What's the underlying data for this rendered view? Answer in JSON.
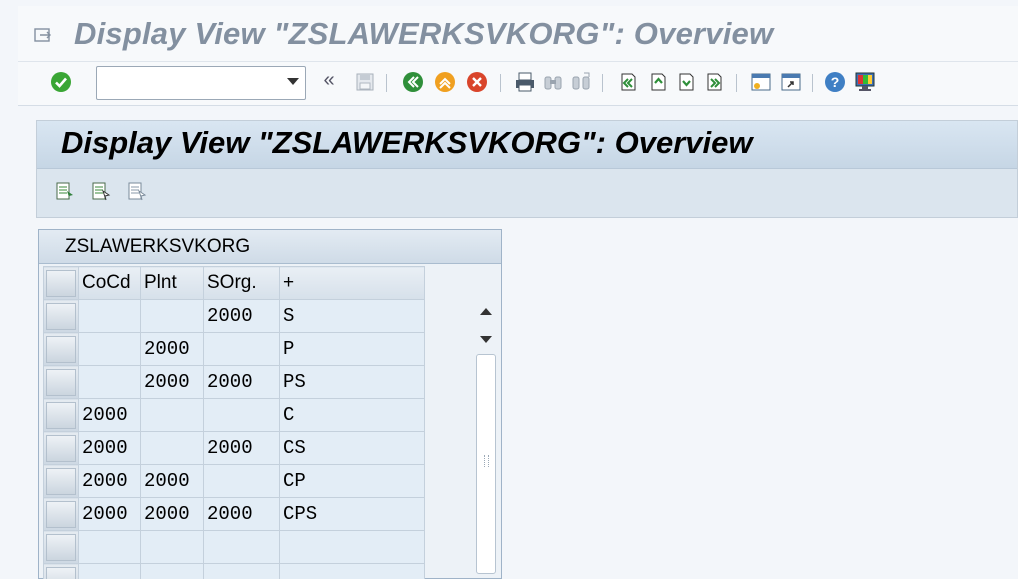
{
  "window": {
    "title": "Display View \"ZSLAWERKSVKORG\": Overview"
  },
  "toolbar": {
    "command_field_value": "",
    "icons": [
      "enter-icon",
      "command-dropdown-icon",
      "collapse-icon",
      "save-icon",
      "back-icon",
      "exit-icon",
      "cancel-icon",
      "print-icon",
      "find-icon",
      "find-next-icon",
      "first-page-icon",
      "previous-page-icon",
      "next-page-icon",
      "last-page-icon",
      "create-session-icon",
      "shortcut-icon",
      "help-icon",
      "customize-layout-icon"
    ],
    "collapse_label": "«"
  },
  "section": {
    "title": "Display View \"ZSLAWERKSVKORG\": Overview",
    "buttons": [
      "details-icon",
      "select-all-icon",
      "deselect-all-icon"
    ]
  },
  "table": {
    "title": "ZSLAWERKSVKORG",
    "columns": [
      "CoCd",
      "Plnt",
      "SOrg.",
      "+"
    ],
    "rows": [
      [
        "",
        "",
        "2000",
        "S"
      ],
      [
        "",
        "2000",
        "",
        "P"
      ],
      [
        "",
        "2000",
        "2000",
        "PS"
      ],
      [
        "2000",
        "",
        "",
        "C"
      ],
      [
        "2000",
        "",
        "2000",
        "CS"
      ],
      [
        "2000",
        "2000",
        "",
        "CP"
      ],
      [
        "2000",
        "2000",
        "2000",
        "CPS"
      ],
      [
        "",
        "",
        "",
        ""
      ],
      [
        "",
        "",
        "",
        ""
      ]
    ]
  },
  "colors": {
    "accent_green": "#3aa635",
    "back_green": "#2f8f3a",
    "exit_orange": "#f0a020",
    "cancel_red": "#d9452b"
  }
}
